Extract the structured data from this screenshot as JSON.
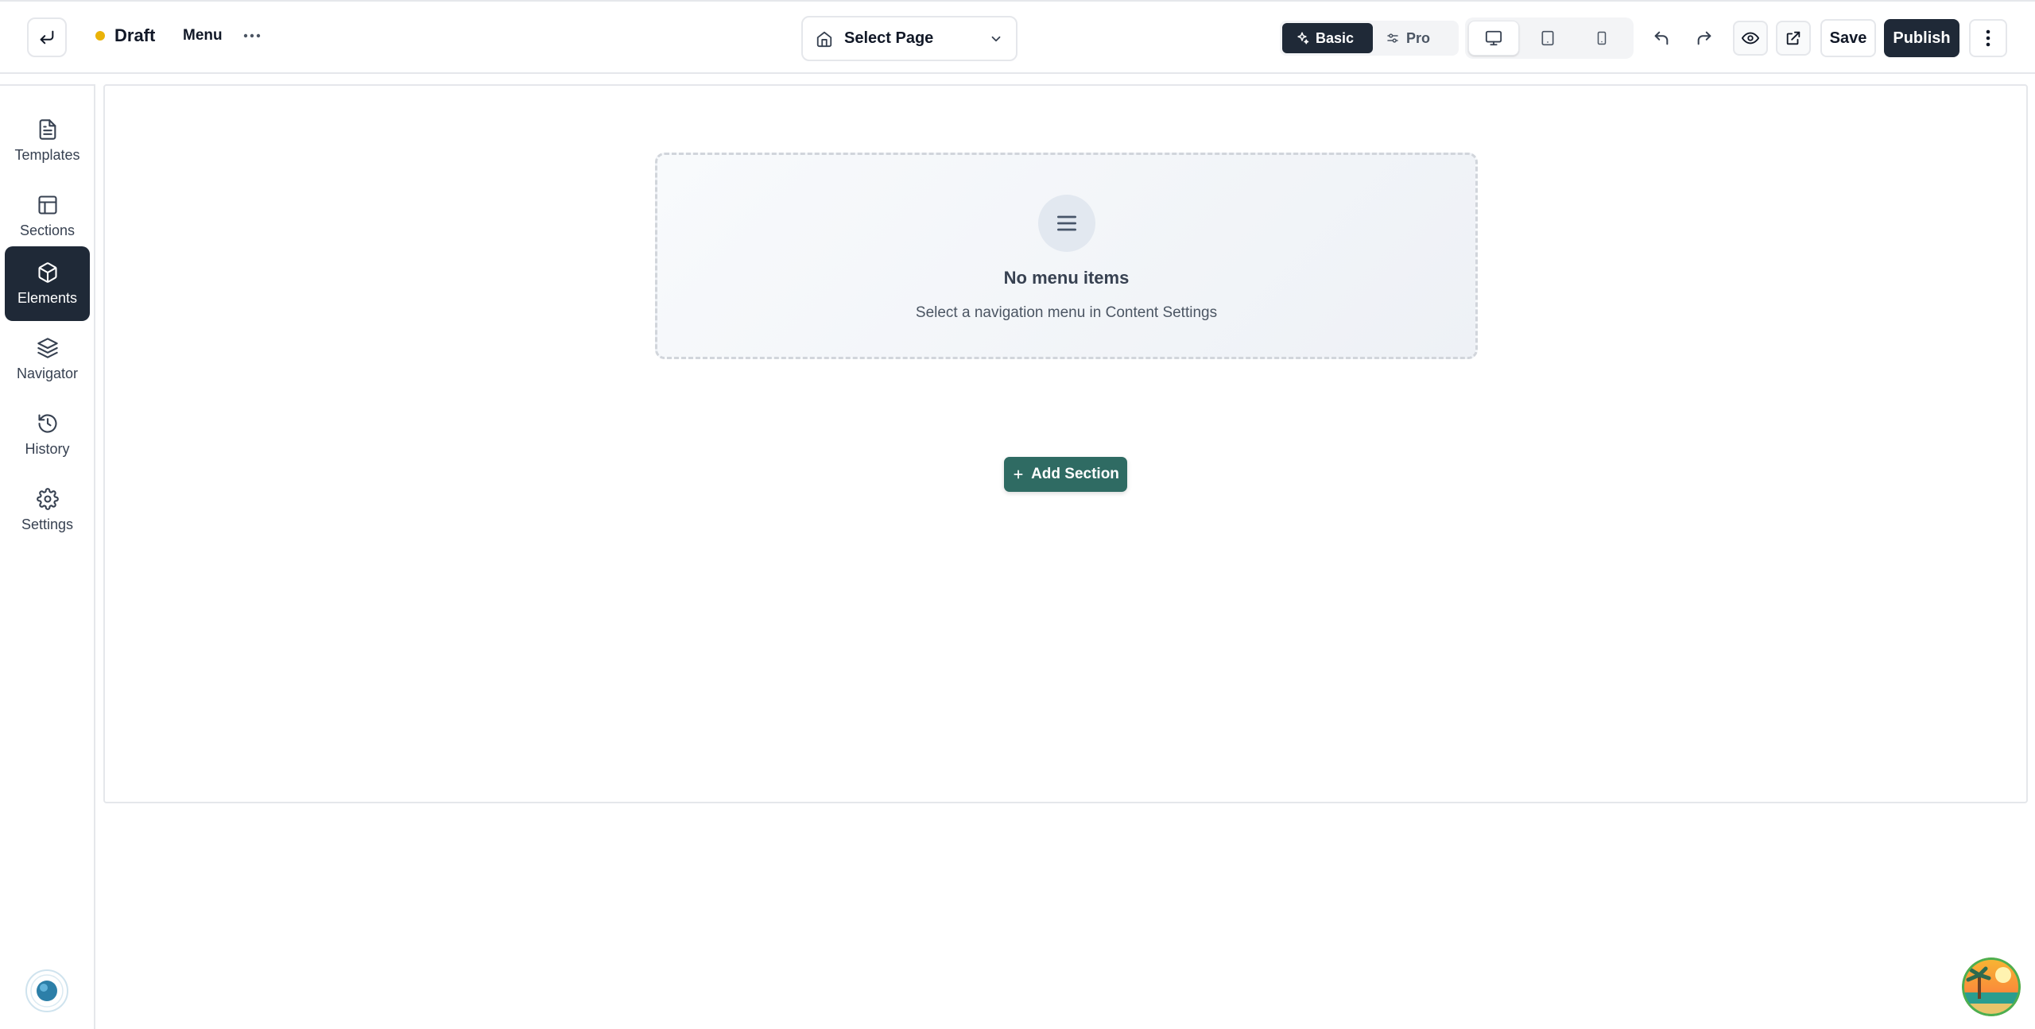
{
  "topbar": {
    "status_label": "Draft",
    "page_name": "Menu",
    "page_select_label": "Select Page",
    "mode_basic": "Basic",
    "mode_pro": "Pro",
    "save_label": "Save",
    "publish_label": "Publish"
  },
  "sidebar": {
    "items": [
      {
        "label": "Templates",
        "icon": "file-text-icon"
      },
      {
        "label": "Sections",
        "icon": "layout-icon"
      },
      {
        "label": "Elements",
        "icon": "box-icon"
      },
      {
        "label": "Navigator",
        "icon": "layers-icon"
      },
      {
        "label": "History",
        "icon": "history-icon"
      },
      {
        "label": "Settings",
        "icon": "gear-icon"
      }
    ],
    "active": "Elements"
  },
  "canvas": {
    "empty_title": "No menu items",
    "empty_subtitle": "Select a navigation menu in Content Settings",
    "add_section_label": "Add Section"
  },
  "colors": {
    "status_dot": "#eab308",
    "accent_dark": "#1f2937",
    "add_section_bg": "#2f6b63"
  }
}
